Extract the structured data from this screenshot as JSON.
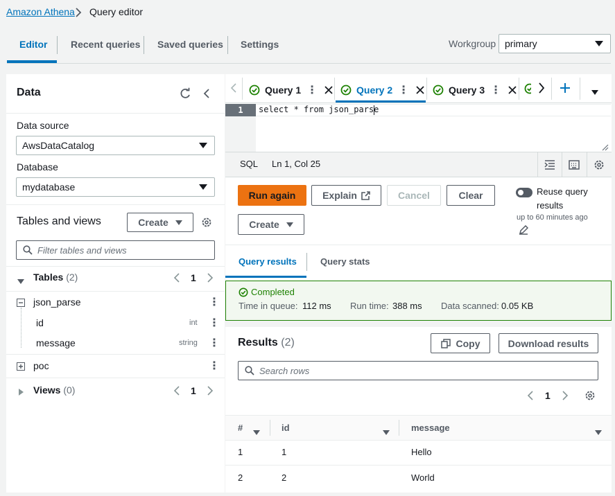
{
  "breadcrumb": {
    "root": "Amazon Athena",
    "current": "Query editor"
  },
  "top_tabs": [
    {
      "label": "Editor",
      "active": true
    },
    {
      "label": "Recent queries",
      "active": false
    },
    {
      "label": "Saved queries",
      "active": false
    },
    {
      "label": "Settings",
      "active": false
    }
  ],
  "workgroup": {
    "label": "Workgroup",
    "value": "primary"
  },
  "data_panel": {
    "title": "Data",
    "data_source_label": "Data source",
    "data_source_value": "AwsDataCatalog",
    "database_label": "Database",
    "database_value": "mydatabase",
    "tables_and_views_title": "Tables and views",
    "create_label": "Create",
    "filter_placeholder": "Filter tables and views",
    "tables_label": "Tables",
    "tables_count": "(2)",
    "tables_page": "1",
    "tables": [
      {
        "name": "json_parse",
        "columns": [
          {
            "name": "id",
            "type": "int"
          },
          {
            "name": "message",
            "type": "string"
          }
        ]
      },
      {
        "name": "poc"
      }
    ],
    "views_label": "Views",
    "views_count": "(0)",
    "views_page": "1"
  },
  "query_tabs": [
    {
      "label": "Query 1",
      "active": false
    },
    {
      "label": "Query 2",
      "active": true
    },
    {
      "label": "Query 3",
      "active": false
    }
  ],
  "editor": {
    "line_number": "1",
    "code": "select * from json_parse",
    "language": "SQL",
    "cursor": "Ln 1, Col 25"
  },
  "actions": {
    "run_label": "Run again",
    "explain_label": "Explain",
    "cancel_label": "Cancel",
    "clear_label": "Clear",
    "create_label": "Create",
    "reuse_label_1": "Reuse query",
    "reuse_label_2": "results",
    "reuse_detail": "up to 60 minutes ago"
  },
  "results_tabs": [
    {
      "label": "Query results",
      "active": true
    },
    {
      "label": "Query stats",
      "active": false
    }
  ],
  "status": {
    "state": "Completed",
    "queue_label": "Time in queue:",
    "queue_value": "112 ms",
    "run_label": "Run time:",
    "run_value": "388 ms",
    "scanned_label": "Data scanned:",
    "scanned_value": "0.05 KB"
  },
  "results": {
    "title": "Results",
    "count": "(2)",
    "copy_label": "Copy",
    "download_label": "Download results",
    "search_placeholder": "Search rows",
    "page": "1",
    "columns": [
      "#",
      "id",
      "message"
    ],
    "rows": [
      [
        "1",
        "1",
        "Hello"
      ],
      [
        "2",
        "2",
        "World"
      ]
    ]
  },
  "colors": {
    "accent": "#0073bb",
    "primary_button": "#ec7211",
    "success": "#1d8102"
  }
}
